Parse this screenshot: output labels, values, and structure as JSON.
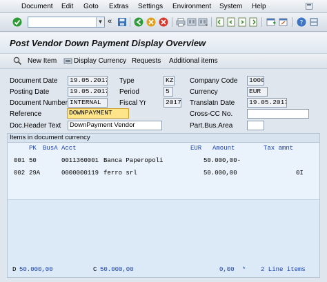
{
  "menu": {
    "items": [
      "Document",
      "Edit",
      "Goto",
      "Extras",
      "Settings",
      "Environment",
      "System",
      "Help"
    ]
  },
  "toolbar": {
    "command_value": "",
    "back_glyph": "«"
  },
  "page": {
    "title": "Post Vendor Down Payment Display Overview"
  },
  "app_toolbar": {
    "new_item": "New Item",
    "display_currency": "Display Currency",
    "requests": "Requests",
    "additional_items": "Additional items"
  },
  "header": {
    "document_date_label": "Document Date",
    "document_date": "19.05.2017",
    "type_label": "Type",
    "type": "KZ",
    "company_code_label": "Company Code",
    "company_code": "1000",
    "posting_date_label": "Posting Date",
    "posting_date": "19.05.2017",
    "period_label": "Period",
    "period": "5",
    "currency_label": "Currency",
    "currency": "EUR",
    "document_number_label": "Document Number",
    "document_number": "INTERNAL",
    "fiscal_yr_label": "Fiscal Yr",
    "fiscal_yr": "2017",
    "translatn_date_label": "Translatn Date",
    "translatn_date": "19.05.2017",
    "reference_label": "Reference",
    "reference": "DOWNPAYMENT",
    "cross_cc_label": "Cross-CC No.",
    "cross_cc": "",
    "doc_header_text_label": "Doc.Header Text",
    "doc_header_text": "DownPayment Vendor",
    "part_bus_area_label": "Part.Bus.Area",
    "part_bus_area": ""
  },
  "items": {
    "section_title": "Items in document currency",
    "columns": {
      "pk": "PK",
      "busa": "BusA",
      "acct": "Acct",
      "eur": "EUR",
      "amount": "Amount",
      "tax_amnt": "Tax amnt"
    },
    "rows": [
      {
        "line": "001",
        "pk": "50",
        "busa": "",
        "acct": "0011360001",
        "name": "Banca Paperopoli",
        "amount": "50.000,00-",
        "tax": ""
      },
      {
        "line": "002",
        "pk": "29A",
        "busa": "",
        "acct": "0000000119",
        "name": "ferro srl",
        "amount": "50.000,00",
        "tax": "0I"
      }
    ]
  },
  "footer": {
    "debit_label": "D",
    "debit_value": "50.000,00",
    "credit_label": "C",
    "credit_value": "50.000,00",
    "balance_value": "0,00",
    "asterisk": "*",
    "line_items": "2 Line items"
  },
  "colors": {
    "accent_blue": "#1a3fb0",
    "reference_highlight": "#ffe58a",
    "panel_bg": "#eaf3fb"
  }
}
